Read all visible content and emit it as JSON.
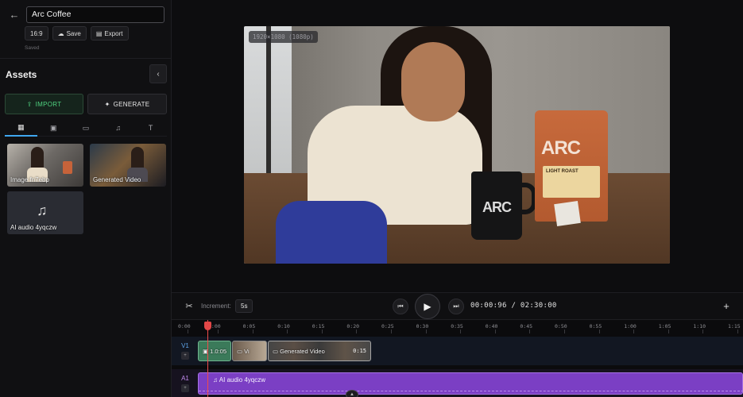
{
  "project": {
    "title": "Arc Coffee",
    "aspect_label": "16:9",
    "save_label": "Save",
    "export_label": "Export",
    "status": "Saved"
  },
  "assets": {
    "heading": "Assets",
    "import_label": "IMPORT",
    "generate_label": "GENERATE",
    "filter_tabs": [
      {
        "icon": "grid-icon",
        "glyph": "▦",
        "active": true
      },
      {
        "icon": "image-icon",
        "glyph": "▣",
        "active": false
      },
      {
        "icon": "video-icon",
        "glyph": "▭",
        "active": false
      },
      {
        "icon": "music-icon",
        "glyph": "♫",
        "active": false
      },
      {
        "icon": "text-icon",
        "glyph": "T",
        "active": false
      }
    ],
    "items": [
      {
        "label": "Image fn7ebp",
        "kind": "image"
      },
      {
        "label": "Generated Video",
        "kind": "video"
      },
      {
        "label": "AI audio 4yqczw",
        "kind": "audio"
      }
    ]
  },
  "preview": {
    "resolution": "1920×1080 (1080p)",
    "mug_text": "ARC",
    "bag_text": "ARC",
    "bag_tag": "LIGHT ROAST"
  },
  "controls": {
    "increment_label": "Increment:",
    "increment_value": "5s",
    "current_time": "00:00:96",
    "total_time": "02:30:00"
  },
  "timeline": {
    "ruler": [
      "0:00",
      "0:00",
      "0:05",
      "0:10",
      "0:15",
      "0:20",
      "0:25",
      "0:30",
      "0:35",
      "0:40",
      "0:45",
      "0:50",
      "0:55",
      "1:00",
      "1:05",
      "1:10",
      "1:15"
    ],
    "video_track_name": "V1",
    "audio_track_name": "A1",
    "clips": [
      {
        "label": "1.0:05",
        "duration": ""
      },
      {
        "label": "Vi",
        "duration": ""
      },
      {
        "label": "Generated Video",
        "duration": "0:15"
      }
    ],
    "audio_clip_label": "AI audio 4yqczw"
  }
}
